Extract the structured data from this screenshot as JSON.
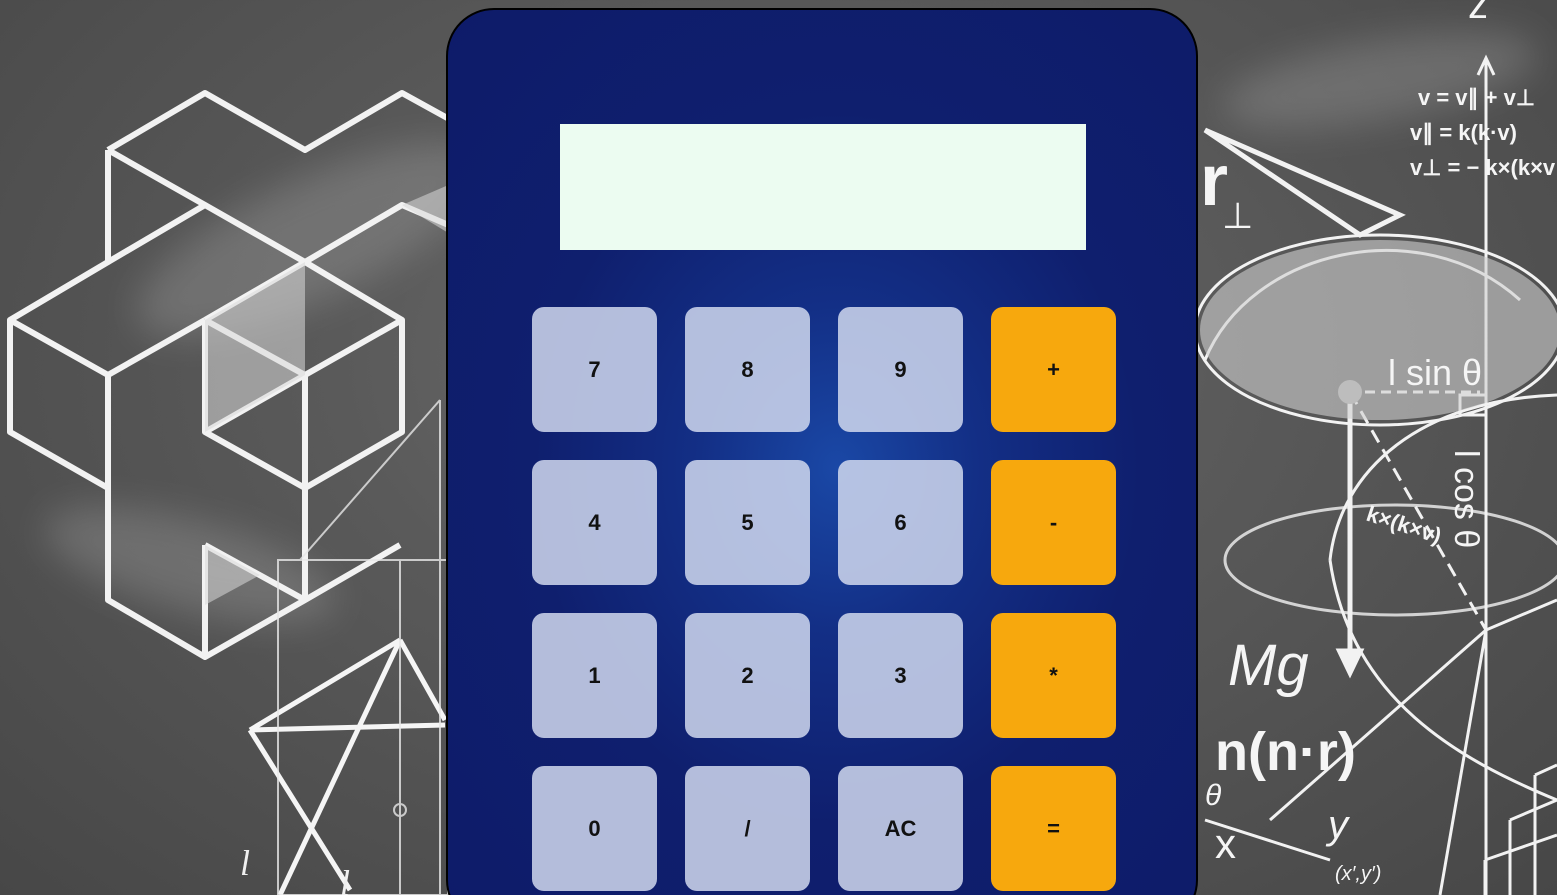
{
  "display": {
    "value": ""
  },
  "keypad": {
    "rows": [
      [
        {
          "label": "7",
          "kind": "digit",
          "name": "key-7-button"
        },
        {
          "label": "8",
          "kind": "digit",
          "name": "key-8-button"
        },
        {
          "label": "9",
          "kind": "digit",
          "name": "key-9-button"
        },
        {
          "label": "+",
          "kind": "op",
          "name": "add-button"
        }
      ],
      [
        {
          "label": "4",
          "kind": "digit",
          "name": "key-4-button"
        },
        {
          "label": "5",
          "kind": "digit",
          "name": "key-5-button"
        },
        {
          "label": "6",
          "kind": "digit",
          "name": "key-6-button"
        },
        {
          "label": "-",
          "kind": "op",
          "name": "subtract-button"
        }
      ],
      [
        {
          "label": "1",
          "kind": "digit",
          "name": "key-1-button"
        },
        {
          "label": "2",
          "kind": "digit",
          "name": "key-2-button"
        },
        {
          "label": "3",
          "kind": "digit",
          "name": "key-3-button"
        },
        {
          "label": "*",
          "kind": "op",
          "name": "multiply-button"
        }
      ],
      [
        {
          "label": "0",
          "kind": "digit",
          "name": "key-0-button"
        },
        {
          "label": "/",
          "kind": "digit",
          "name": "divide-button"
        },
        {
          "label": "AC",
          "kind": "digit",
          "name": "clear-button"
        },
        {
          "label": "=",
          "kind": "op",
          "name": "equals-button"
        }
      ]
    ]
  },
  "background_text": {
    "left": {
      "l1": "l",
      "l2": "l"
    },
    "right": {
      "z": "z",
      "eq1": "v = v∥ + v⊥",
      "eq2": "v∥ = k(k·v)",
      "eq3": "v⊥ = − k×(k×v",
      "r": "r",
      "perp": "⊥",
      "lsin": "l sin θ",
      "lcos": "l cos θ",
      "kxkv": "k×(k×v)",
      "mg": "Mg",
      "nnr": "n(n·r)",
      "theta": "θ",
      "x": "x",
      "y": "y",
      "xy": "(x′,y′)"
    }
  },
  "colors": {
    "calculator_body": "#0e1b69",
    "calculator_glow": "#1a48a6",
    "display_bg": "#ecfcf1",
    "key_bg": "#cfd7ee",
    "operator_key_bg": "#f7a80d",
    "chalkboard": "#5a5a5a",
    "chalk": "#ffffff"
  }
}
